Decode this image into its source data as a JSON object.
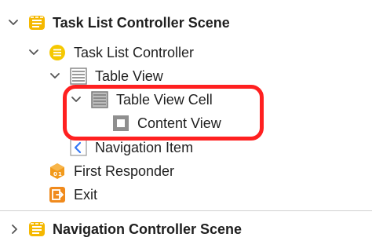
{
  "outline": {
    "task_list_scene": "Task List Controller Scene",
    "task_list_controller": "Task List Controller",
    "table_view": "Table View",
    "table_view_cell": "Table View Cell",
    "content_view": "Content View",
    "navigation_item": "Navigation Item",
    "first_responder": "First Responder",
    "exit": "Exit",
    "navigation_scene": "Navigation Controller Scene"
  },
  "colors": {
    "scene_icon": "#f5b800",
    "controller_icon": "#f5c800",
    "first_responder_icon": "#f29a1c",
    "exit_icon": "#f08a1c",
    "navigation_icon_border": "#3478f6",
    "highlight": "#ff2020"
  },
  "icons": {
    "scene": "scene-icon",
    "controller": "view-controller-icon",
    "table_view": "table-view-icon",
    "table_view_cell": "table-view-cell-icon",
    "content_view": "content-view-icon",
    "navigation_item": "navigation-item-icon",
    "first_responder": "first-responder-icon",
    "exit": "exit-icon"
  }
}
